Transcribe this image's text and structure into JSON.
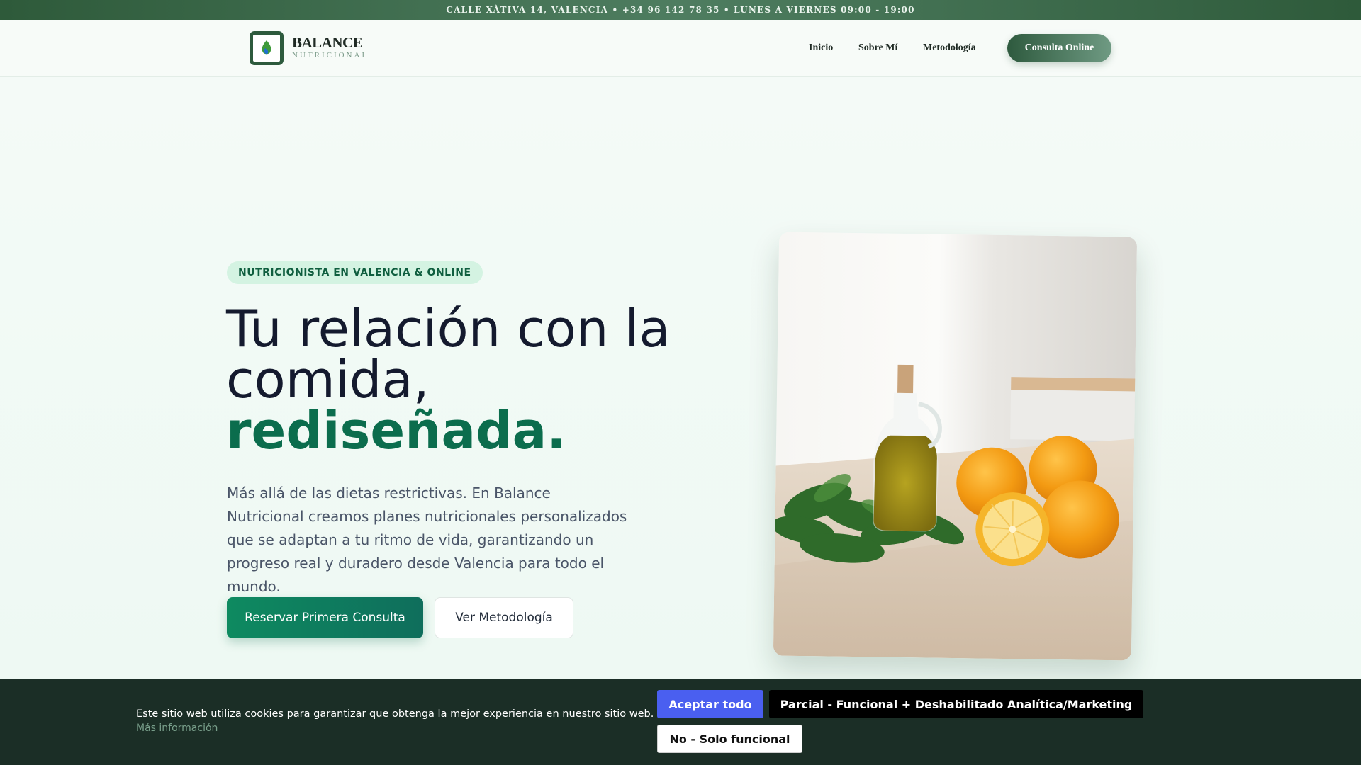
{
  "topbar": {
    "info": "CALLE XÀTIVA 14, VALENCIA • +34 96 142 78 35 • LUNES A VIERNES 09:00 - 19:00"
  },
  "header": {
    "logo_title": "BALANCE",
    "logo_subtitle": "NUTRICIONAL",
    "nav": {
      "inicio": "Inicio",
      "sobre": "Sobre Mí",
      "metodologia": "Metodología"
    },
    "cta": "Consulta Online"
  },
  "hero": {
    "badge": "NUTRICIONISTA EN VALENCIA & ONLINE",
    "title_line1": "Tu relación con la",
    "title_line2": "comida,",
    "title_accent": "rediseñada.",
    "description": "Más allá de las dietas restrictivas. En Balance Nutricional creamos planes nutricionales personalizados que se adaptan a tu ritmo de vida, garantizando un progreso real y duradero desde Valencia para todo el mundo.",
    "primary_button": "Reservar Primera Consulta",
    "secondary_button": "Ver Metodología"
  },
  "cookie": {
    "text": "Este sitio web utiliza cookies para garantizar que obtenga la mejor experiencia en nuestro sitio web.",
    "link": "Más información",
    "accept": "Aceptar todo",
    "partial": "Parcial - Funcional + Deshabilitado Analítica/Marketing",
    "no": "No - Solo funcional"
  },
  "colors": {
    "brand_green": "#2d5a3d",
    "accent_green": "#0b6d4d",
    "cookie_bg": "#1b2e26",
    "accept_blue": "#4a5ff0"
  }
}
